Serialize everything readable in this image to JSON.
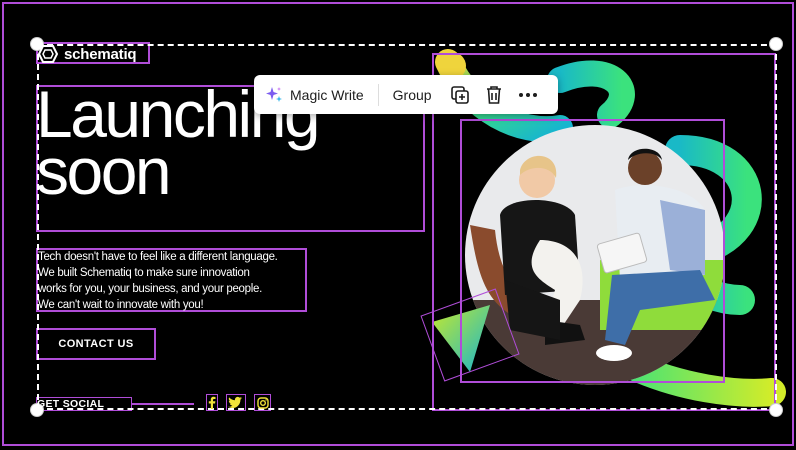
{
  "toolbar": {
    "magic_write_label": "Magic Write",
    "group_label": "Group"
  },
  "design": {
    "logo_text": "schematiq",
    "headline": "Launching\nsoon",
    "body_copy": "Tech doesn't have to feel like a different language.\nWe built Schematiq to make sure innovation\nworks for you, your business, and your people.\nWe can't wait to innovate with you!",
    "cta_label": "CONTACT US",
    "social_label": "GET SOCIAL",
    "social_icons": [
      "facebook-icon",
      "twitter-icon",
      "instagram-icon"
    ]
  },
  "colors": {
    "background": "#000000",
    "selection": "#b04dd8",
    "accent_yellow": "#f2e33a",
    "gradient_green": "#3ee27a",
    "gradient_teal": "#19b3c9",
    "gradient_lime": "#c7ea2a"
  }
}
